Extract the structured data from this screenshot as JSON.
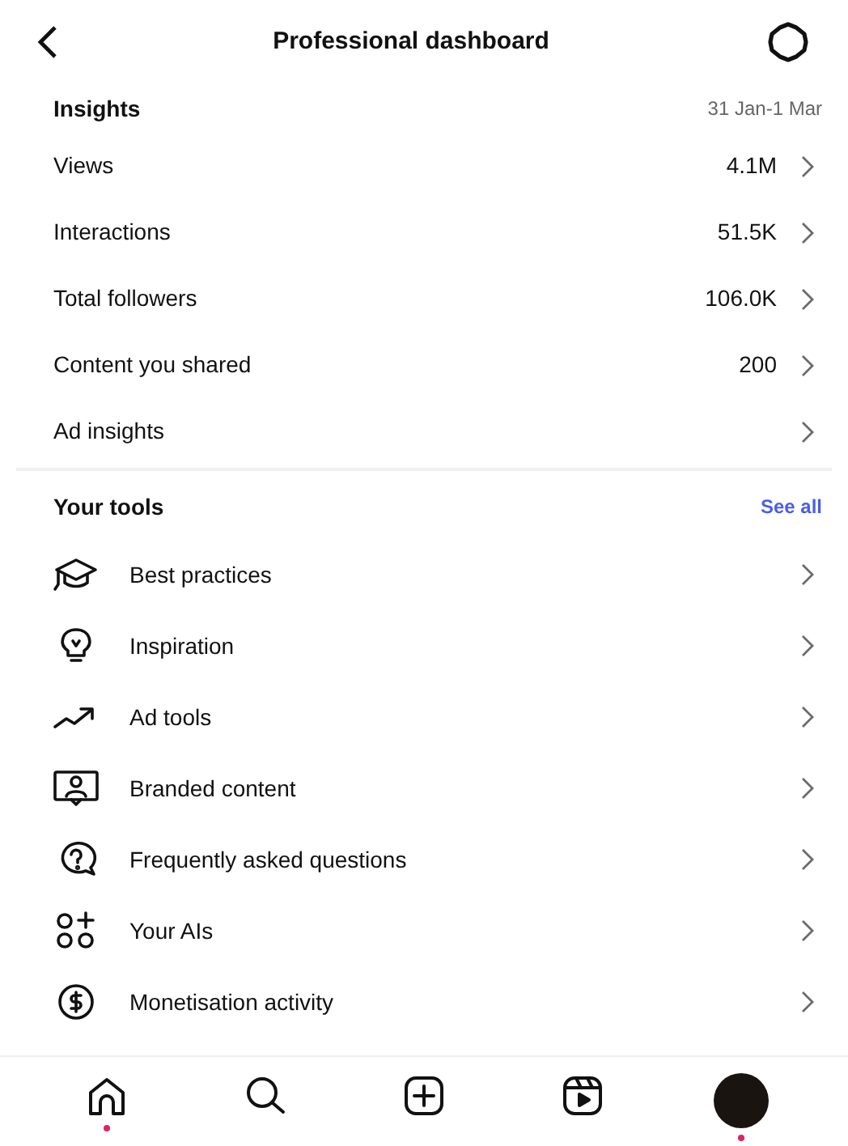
{
  "header": {
    "title": "Professional dashboard"
  },
  "insights": {
    "title": "Insights",
    "date_range": "31 Jan-1 Mar",
    "rows": [
      {
        "label": "Views",
        "value": "4.1M"
      },
      {
        "label": "Interactions",
        "value": "51.5K"
      },
      {
        "label": "Total followers",
        "value": "106.0K"
      },
      {
        "label": "Content you shared",
        "value": "200"
      },
      {
        "label": "Ad insights"
      }
    ]
  },
  "tools": {
    "title": "Your tools",
    "link": "See all",
    "items": [
      {
        "kind": "cap",
        "label": "Best practices"
      },
      {
        "kind": "bulb",
        "label": "Inspiration"
      },
      {
        "kind": "trend",
        "label": "Ad tools"
      },
      {
        "kind": "branded",
        "label": "Branded content"
      },
      {
        "kind": "faq",
        "label": "Frequently asked questions"
      },
      {
        "kind": "ai",
        "label": "Your AIs"
      },
      {
        "kind": "money",
        "label": "Monetisation activity"
      }
    ]
  },
  "nav": [
    {
      "kind": "home",
      "dot": true
    },
    {
      "kind": "search",
      "dot": false
    },
    {
      "kind": "create",
      "dot": false
    },
    {
      "kind": "reels",
      "dot": false
    },
    {
      "kind": "profile",
      "dot": true
    }
  ]
}
